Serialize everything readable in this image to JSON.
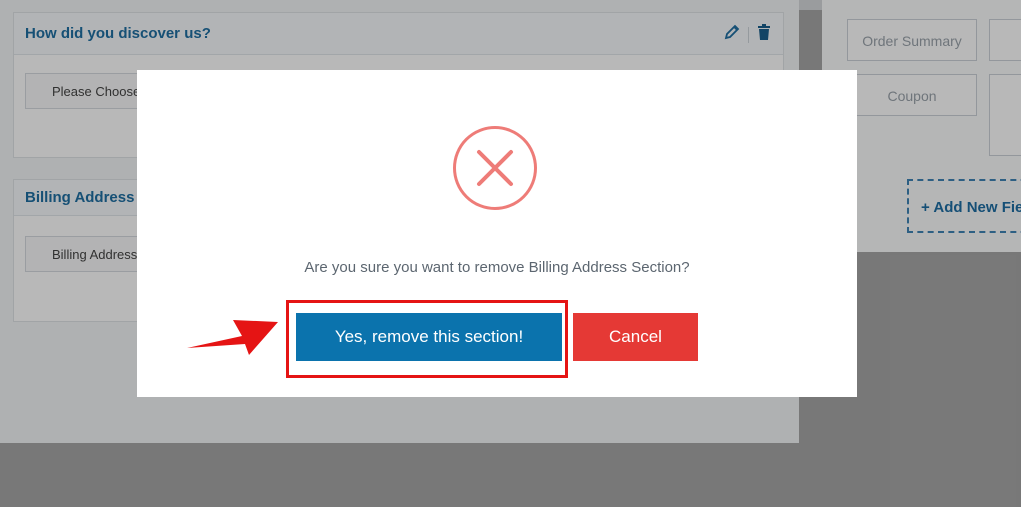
{
  "background": {
    "sections": [
      {
        "title": "How did you discover us?",
        "field": "Please Choose"
      },
      {
        "title": "Billing Address",
        "field": "Billing Address"
      }
    ],
    "right_panel": {
      "order_summary": "Order Summary",
      "coupon": "Coupon",
      "add_new_field": "+  Add New Field"
    }
  },
  "modal": {
    "icon": "error-circle-x-icon",
    "message": "Are you sure you want to remove Billing Address Section?",
    "confirm_label": "Yes, remove this section!",
    "cancel_label": "Cancel"
  },
  "colors": {
    "accent": "#0b73ad",
    "danger": "#e53935",
    "error_icon": "#ee7c78",
    "highlight": "#e51414"
  }
}
